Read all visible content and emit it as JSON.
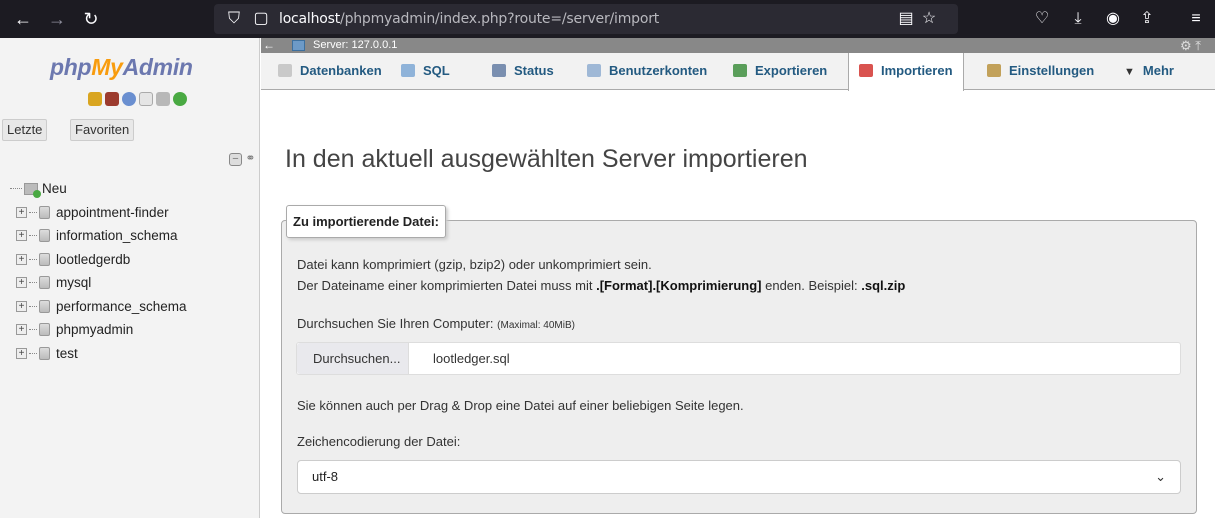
{
  "browser": {
    "url_host": "localhost",
    "url_path": "/phpmyadmin/index.php?route=/server/import"
  },
  "nav": {
    "logo": {
      "php": "php",
      "my": "My",
      "admin": "Admin"
    },
    "tab_recent": "Letzte",
    "tab_favorites": "Favoriten",
    "new_label": "Neu",
    "databases": [
      "appointment-finder",
      "information_schema",
      "lootledgerdb",
      "mysql",
      "performance_schema",
      "phpmyadmin",
      "test"
    ]
  },
  "server_bar": {
    "label": "Server: 127.0.0.1"
  },
  "tabs": [
    {
      "label": "Datenbanken",
      "icon": "databases-icon",
      "color": "#c9c9c9"
    },
    {
      "label": "SQL",
      "icon": "sql-icon",
      "color": "#8fb3d9"
    },
    {
      "label": "Status",
      "icon": "status-icon",
      "color": "#7a8fb0"
    },
    {
      "label": "Benutzerkonten",
      "icon": "users-icon",
      "color": "#9fb8d6"
    },
    {
      "label": "Exportieren",
      "icon": "export-icon",
      "color": "#5a9e5a"
    },
    {
      "label": "Importieren",
      "icon": "import-icon",
      "color": "#d9534f"
    },
    {
      "label": "Einstellungen",
      "icon": "wrench-icon",
      "color": "#c2a15a"
    },
    {
      "label": "Mehr",
      "icon": "caret-down-icon",
      "color": "#333333"
    }
  ],
  "main": {
    "title": "In den aktuell ausgewählten Server importieren",
    "legend": "Zu importierende Datei:",
    "line1": "Datei kann komprimiert (gzip, bzip2) oder unkomprimiert sein.",
    "line2_pre": "Der Dateiname einer komprimierten Datei muss mit ",
    "line2_bold": ".[Format].[Komprimierung]",
    "line2_mid": " enden. Beispiel: ",
    "line2_example": ".sql.zip",
    "browse_label": "Durchsuchen Sie Ihren Computer: ",
    "max_size": "(Maximal: 40MiB)",
    "browse_button": "Durchsuchen...",
    "file_name": "lootledger.sql",
    "drag_drop": "Sie können auch per Drag & Drop eine Datei auf einer beliebigen Seite legen.",
    "charset_label": "Zeichencodierung der Datei:",
    "charset_value": "utf-8"
  }
}
